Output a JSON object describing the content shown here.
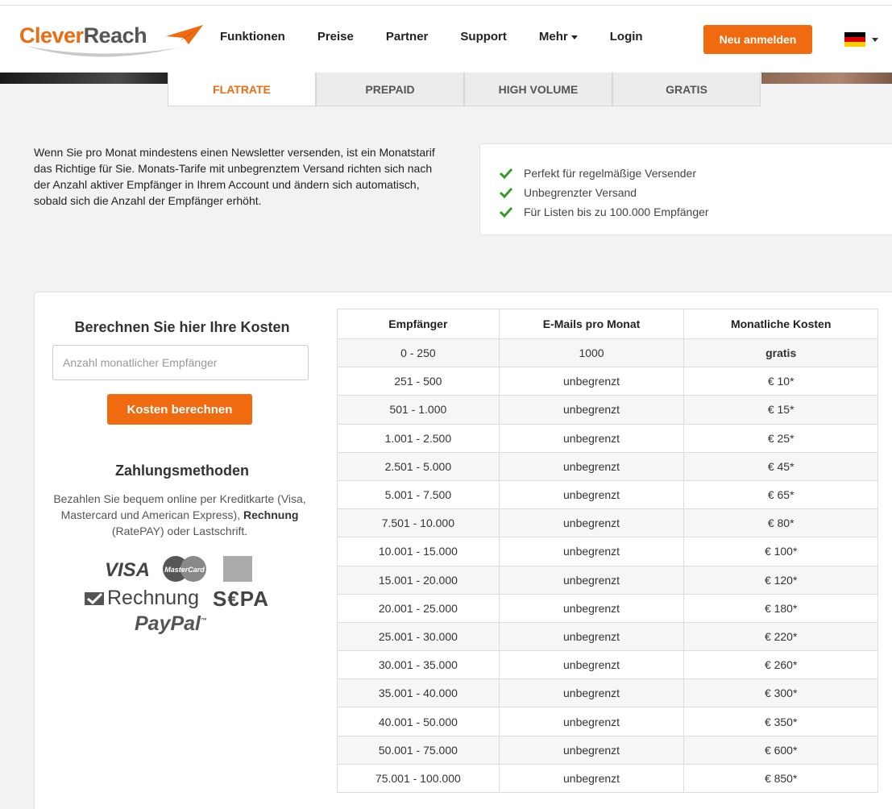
{
  "brand": {
    "name_part1": "Clever",
    "name_part2": "Reach"
  },
  "nav": {
    "items": [
      {
        "label": "Funktionen"
      },
      {
        "label": "Preise"
      },
      {
        "label": "Partner"
      },
      {
        "label": "Support"
      },
      {
        "label": "Mehr",
        "dropdown": true
      },
      {
        "label": "Login"
      }
    ],
    "signup_label": "Neu anmelden",
    "language_flag_icon": "german-flag-icon"
  },
  "colors": {
    "accent": "#f06b0f",
    "check": "#3a9a2a"
  },
  "tabs": [
    {
      "label": "FLATRATE",
      "active": true
    },
    {
      "label": "PREPAID"
    },
    {
      "label": "HIGH VOLUME"
    },
    {
      "label": "GRATIS"
    }
  ],
  "intro": {
    "text": "Wenn Sie pro Monat mindestens einen Newsletter versenden, ist ein Monatstarif das Richtige für Sie. Monats-Tarife mit unbegrenztem Versand richten sich nach der Anzahl aktiver Empfänger in Ihrem Account und ändern sich automatisch, sobald sich die Anzahl der Empfänger erhöht."
  },
  "features": [
    "Perfekt für regelmäßige Versender",
    "Unbegrenzter Versand",
    "Für Listen bis zu 100.000 Empfänger"
  ],
  "calculator": {
    "title": "Berechnen Sie hier Ihre Kosten",
    "input_placeholder": "Anzahl monatlicher Empfänger",
    "input_value": "",
    "button_label": "Kosten berechnen"
  },
  "payment": {
    "title": "Zahlungsmethoden",
    "text_part1": "Bezahlen Sie bequem online per Kreditkarte (Visa, Mastercard und American Express), ",
    "text_bold": "Rechnung",
    "text_part2": " (RatePAY) oder Lastschrift.",
    "logos": {
      "visa": "VISA",
      "mastercard": "MasterCard",
      "rechnung": "Rechnung",
      "sepa": "S€PA",
      "paypal": "PayPal",
      "paypal_tm": "™"
    }
  },
  "price_table": {
    "headers": [
      "Empfänger",
      "E-Mails pro Monat",
      "Monatliche Kosten"
    ],
    "rows": [
      [
        "0 - 250",
        "1000",
        "gratis"
      ],
      [
        "251 - 500",
        "unbegrenzt",
        "€ 10*"
      ],
      [
        "501 - 1.000",
        "unbegrenzt",
        "€ 15*"
      ],
      [
        "1.001 - 2.500",
        "unbegrenzt",
        "€ 25*"
      ],
      [
        "2.501 - 5.000",
        "unbegrenzt",
        "€ 45*"
      ],
      [
        "5.001 - 7.500",
        "unbegrenzt",
        "€ 65*"
      ],
      [
        "7.501 - 10.000",
        "unbegrenzt",
        "€ 80*"
      ],
      [
        "10.001 - 15.000",
        "unbegrenzt",
        "€ 100*"
      ],
      [
        "15.001 - 20.000",
        "unbegrenzt",
        "€ 120*"
      ],
      [
        "20.001 - 25.000",
        "unbegrenzt",
        "€ 180*"
      ],
      [
        "25.001 - 30.000",
        "unbegrenzt",
        "€ 220*"
      ],
      [
        "30.001 - 35.000",
        "unbegrenzt",
        "€ 260*"
      ],
      [
        "35.001 - 40.000",
        "unbegrenzt",
        "€ 300*"
      ],
      [
        "40.001 - 50.000",
        "unbegrenzt",
        "€ 350*"
      ],
      [
        "50.001 - 75.000",
        "unbegrenzt",
        "€ 600*"
      ],
      [
        "75.001 - 100.000",
        "unbegrenzt",
        "€ 850*"
      ]
    ]
  }
}
